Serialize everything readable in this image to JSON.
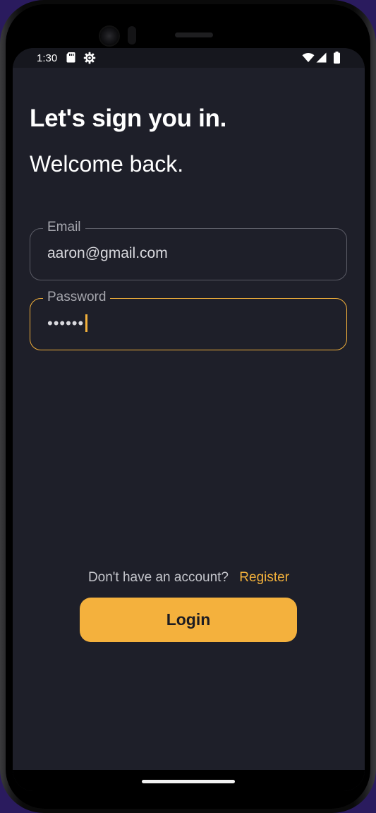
{
  "status_bar": {
    "time": "1:30",
    "icons": [
      "sd-card-icon",
      "settings-gear-icon",
      "wifi-icon",
      "cellular-signal-icon",
      "battery-icon"
    ]
  },
  "header": {
    "title": "Let's sign you in.",
    "subtitle": "Welcome back."
  },
  "form": {
    "email": {
      "label": "Email",
      "value": "aaron@gmail.com"
    },
    "password": {
      "label": "Password",
      "masked_value": "••••••",
      "focused": true
    }
  },
  "footer": {
    "register_prompt": "Don't have an account?",
    "register_link": "Register",
    "login_label": "Login"
  },
  "colors": {
    "background": "#1e1f29",
    "accent": "#f4b13d",
    "text": "#ffffff",
    "muted_text": "#a6a7ae"
  }
}
